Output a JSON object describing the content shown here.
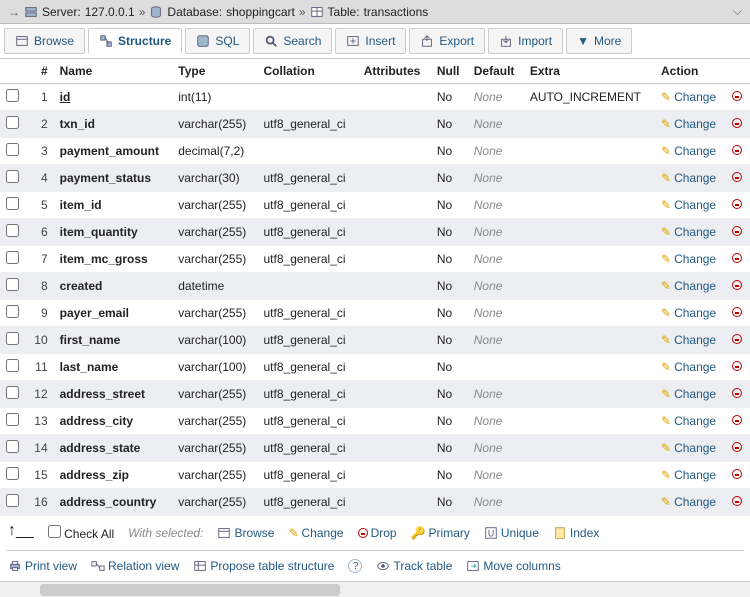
{
  "breadcrumb": {
    "server_label": "Server:",
    "server_value": "127.0.0.1",
    "db_label": "Database:",
    "db_value": "shoppingcart",
    "table_label": "Table:",
    "table_value": "transactions",
    "sep": "»"
  },
  "tabs": {
    "browse": "Browse",
    "structure": "Structure",
    "sql": "SQL",
    "search": "Search",
    "insert": "Insert",
    "export": "Export",
    "import": "Import",
    "more": "More"
  },
  "headers": {
    "num": "#",
    "name": "Name",
    "type": "Type",
    "collation": "Collation",
    "attributes": "Attributes",
    "null": "Null",
    "default": "Default",
    "extra": "Extra",
    "action": "Action"
  },
  "action_labels": {
    "change": "Change"
  },
  "columns": [
    {
      "n": 1,
      "name": "id",
      "type": "int(11)",
      "coll": "",
      "null": "No",
      "def": "None",
      "extra": "AUTO_INCREMENT",
      "pk": true
    },
    {
      "n": 2,
      "name": "txn_id",
      "type": "varchar(255)",
      "coll": "utf8_general_ci",
      "null": "No",
      "def": "None",
      "extra": ""
    },
    {
      "n": 3,
      "name": "payment_amount",
      "type": "decimal(7,2)",
      "coll": "",
      "null": "No",
      "def": "None",
      "extra": ""
    },
    {
      "n": 4,
      "name": "payment_status",
      "type": "varchar(30)",
      "coll": "utf8_general_ci",
      "null": "No",
      "def": "None",
      "extra": ""
    },
    {
      "n": 5,
      "name": "item_id",
      "type": "varchar(255)",
      "coll": "utf8_general_ci",
      "null": "No",
      "def": "None",
      "extra": ""
    },
    {
      "n": 6,
      "name": "item_quantity",
      "type": "varchar(255)",
      "coll": "utf8_general_ci",
      "null": "No",
      "def": "None",
      "extra": ""
    },
    {
      "n": 7,
      "name": "item_mc_gross",
      "type": "varchar(255)",
      "coll": "utf8_general_ci",
      "null": "No",
      "def": "None",
      "extra": ""
    },
    {
      "n": 8,
      "name": "created",
      "type": "datetime",
      "coll": "",
      "null": "No",
      "def": "None",
      "extra": ""
    },
    {
      "n": 9,
      "name": "payer_email",
      "type": "varchar(255)",
      "coll": "utf8_general_ci",
      "null": "No",
      "def": "None",
      "extra": ""
    },
    {
      "n": 10,
      "name": "first_name",
      "type": "varchar(100)",
      "coll": "utf8_general_ci",
      "null": "No",
      "def": "None",
      "extra": ""
    },
    {
      "n": 11,
      "name": "last_name",
      "type": "varchar(100)",
      "coll": "utf8_general_ci",
      "null": "No",
      "def": "",
      "extra": ""
    },
    {
      "n": 12,
      "name": "address_street",
      "type": "varchar(255)",
      "coll": "utf8_general_ci",
      "null": "No",
      "def": "None",
      "extra": ""
    },
    {
      "n": 13,
      "name": "address_city",
      "type": "varchar(255)",
      "coll": "utf8_general_ci",
      "null": "No",
      "def": "None",
      "extra": ""
    },
    {
      "n": 14,
      "name": "address_state",
      "type": "varchar(255)",
      "coll": "utf8_general_ci",
      "null": "No",
      "def": "None",
      "extra": ""
    },
    {
      "n": 15,
      "name": "address_zip",
      "type": "varchar(255)",
      "coll": "utf8_general_ci",
      "null": "No",
      "def": "None",
      "extra": ""
    },
    {
      "n": 16,
      "name": "address_country",
      "type": "varchar(255)",
      "coll": "utf8_general_ci",
      "null": "No",
      "def": "None",
      "extra": ""
    }
  ],
  "toolbar": {
    "check_all": "Check All",
    "with_selected": "With selected:",
    "browse": "Browse",
    "change": "Change",
    "drop": "Drop",
    "primary": "Primary",
    "unique": "Unique",
    "index": "Index"
  },
  "footer": {
    "print": "Print view",
    "relation": "Relation view",
    "propose": "Propose table structure",
    "track": "Track table",
    "move": "Move columns"
  }
}
